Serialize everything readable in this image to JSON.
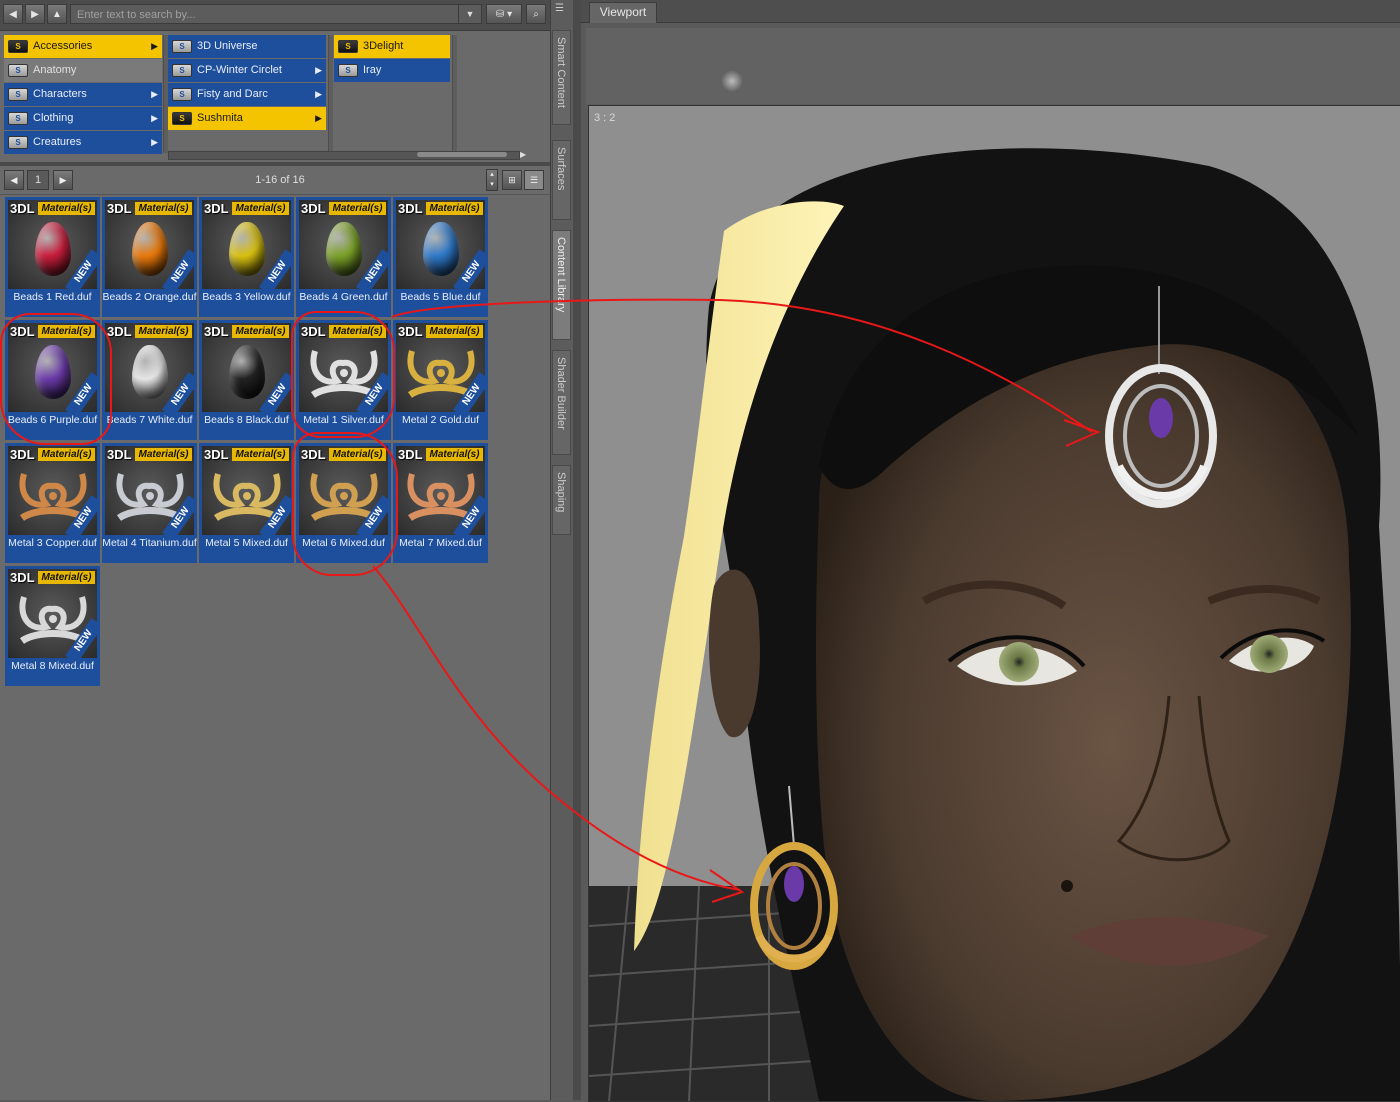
{
  "toolbar": {
    "back_icon": "arrow-left-icon",
    "forward_icon": "arrow-right-icon",
    "up_icon": "arrow-up-icon",
    "search_placeholder": "Enter text to search by..."
  },
  "categories": {
    "col1": [
      {
        "label": "Accessories",
        "selected": true
      },
      {
        "label": "Anatomy",
        "selected": false
      },
      {
        "label": "Characters",
        "selected": false
      },
      {
        "label": "Clothing",
        "selected": false
      },
      {
        "label": "Creatures",
        "selected": false
      }
    ],
    "col2": [
      {
        "label": "3D Universe",
        "selected": false
      },
      {
        "label": "CP-Winter Circlet",
        "selected": false
      },
      {
        "label": "Fisty and Darc",
        "selected": false
      },
      {
        "label": "Sushmita",
        "selected": true
      }
    ],
    "col3": [
      {
        "label": "3Delight",
        "selected": true
      },
      {
        "label": "Iray",
        "selected": false
      }
    ]
  },
  "pager": {
    "page": "1",
    "count": "1-16 of 16"
  },
  "tile_badges": {
    "engine": "3DL",
    "type": "Material(s)",
    "new": "NEW"
  },
  "tiles": [
    {
      "label": "Beads 1 Red.duf",
      "kind": "bead",
      "color": "#c81e3c"
    },
    {
      "label": "Beads 2 Orange.duf",
      "kind": "bead",
      "color": "#e8780a"
    },
    {
      "label": "Beads 3 Yellow.duf",
      "kind": "bead",
      "color": "#d8c010"
    },
    {
      "label": "Beads 4 Green.duf",
      "kind": "bead",
      "color": "#7aa028"
    },
    {
      "label": "Beads 5 Blue.duf",
      "kind": "bead",
      "color": "#2e78c8"
    },
    {
      "label": "Beads 6 Purple.duf",
      "kind": "bead",
      "color": "#6a3aa8"
    },
    {
      "label": "Beads 7 White.duf",
      "kind": "bead",
      "color": "#e6e6e6"
    },
    {
      "label": "Beads 8 Black.duf",
      "kind": "bead",
      "color": "#222222"
    },
    {
      "label": "Metal 1 Silver.duf",
      "kind": "metal",
      "color": "#e0e0e0"
    },
    {
      "label": "Metal 2 Gold.duf",
      "kind": "metal",
      "color": "#d8b040"
    },
    {
      "label": "Metal 3 Copper.duf",
      "kind": "metal",
      "color": "#d08848"
    },
    {
      "label": "Metal 4 Titanium.duf",
      "kind": "metal",
      "color": "#c8ccd2"
    },
    {
      "label": "Metal 5 Mixed.duf",
      "kind": "metal",
      "color": "#d8b860"
    },
    {
      "label": "Metal 6 Mixed.duf",
      "kind": "metal",
      "color": "#d0a050"
    },
    {
      "label": "Metal 7 Mixed.duf",
      "kind": "metal",
      "color": "#d89060"
    },
    {
      "label": "Metal 8 Mixed.duf",
      "kind": "metal",
      "color": "#d8d8d8"
    }
  ],
  "side_tabs": [
    "Smart Content",
    "Surfaces",
    "Content Library",
    "Shader Builder",
    "Shaping"
  ],
  "viewport": {
    "tab": "Viewport",
    "ratio": "3 : 2"
  },
  "colors": {
    "selection_yellow": "#f5c400",
    "folder_blue": "#1e4f9c",
    "annotation_red": "#e81818"
  }
}
